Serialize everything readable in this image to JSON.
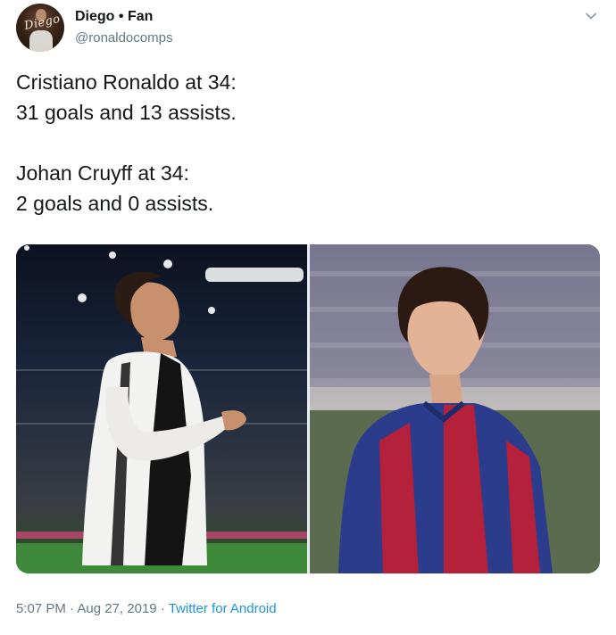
{
  "author": {
    "display_name": "Diego • Fan",
    "handle": "@ronaldocomps",
    "avatar_text": "Diego"
  },
  "tweet": {
    "text": "Cristiano Ronaldo at 34:\n31 goals and 13 assists.\n\nJohan Cruyff at 34:\n2 goals and 0 assists.",
    "time": "5:07 PM",
    "separator": "·",
    "date": "Aug 27, 2019",
    "source": "Twitter for Android"
  },
  "media": {
    "left_photo": "Cristiano Ronaldo in Juventus kit celebrating",
    "right_photo": "Johan Cruyff in Barcelona kit"
  },
  "icons": {
    "caret": "chevron-down-icon"
  },
  "colors": {
    "text_primary": "#14171a",
    "text_secondary": "#657786",
    "link": "#1b95e0"
  }
}
